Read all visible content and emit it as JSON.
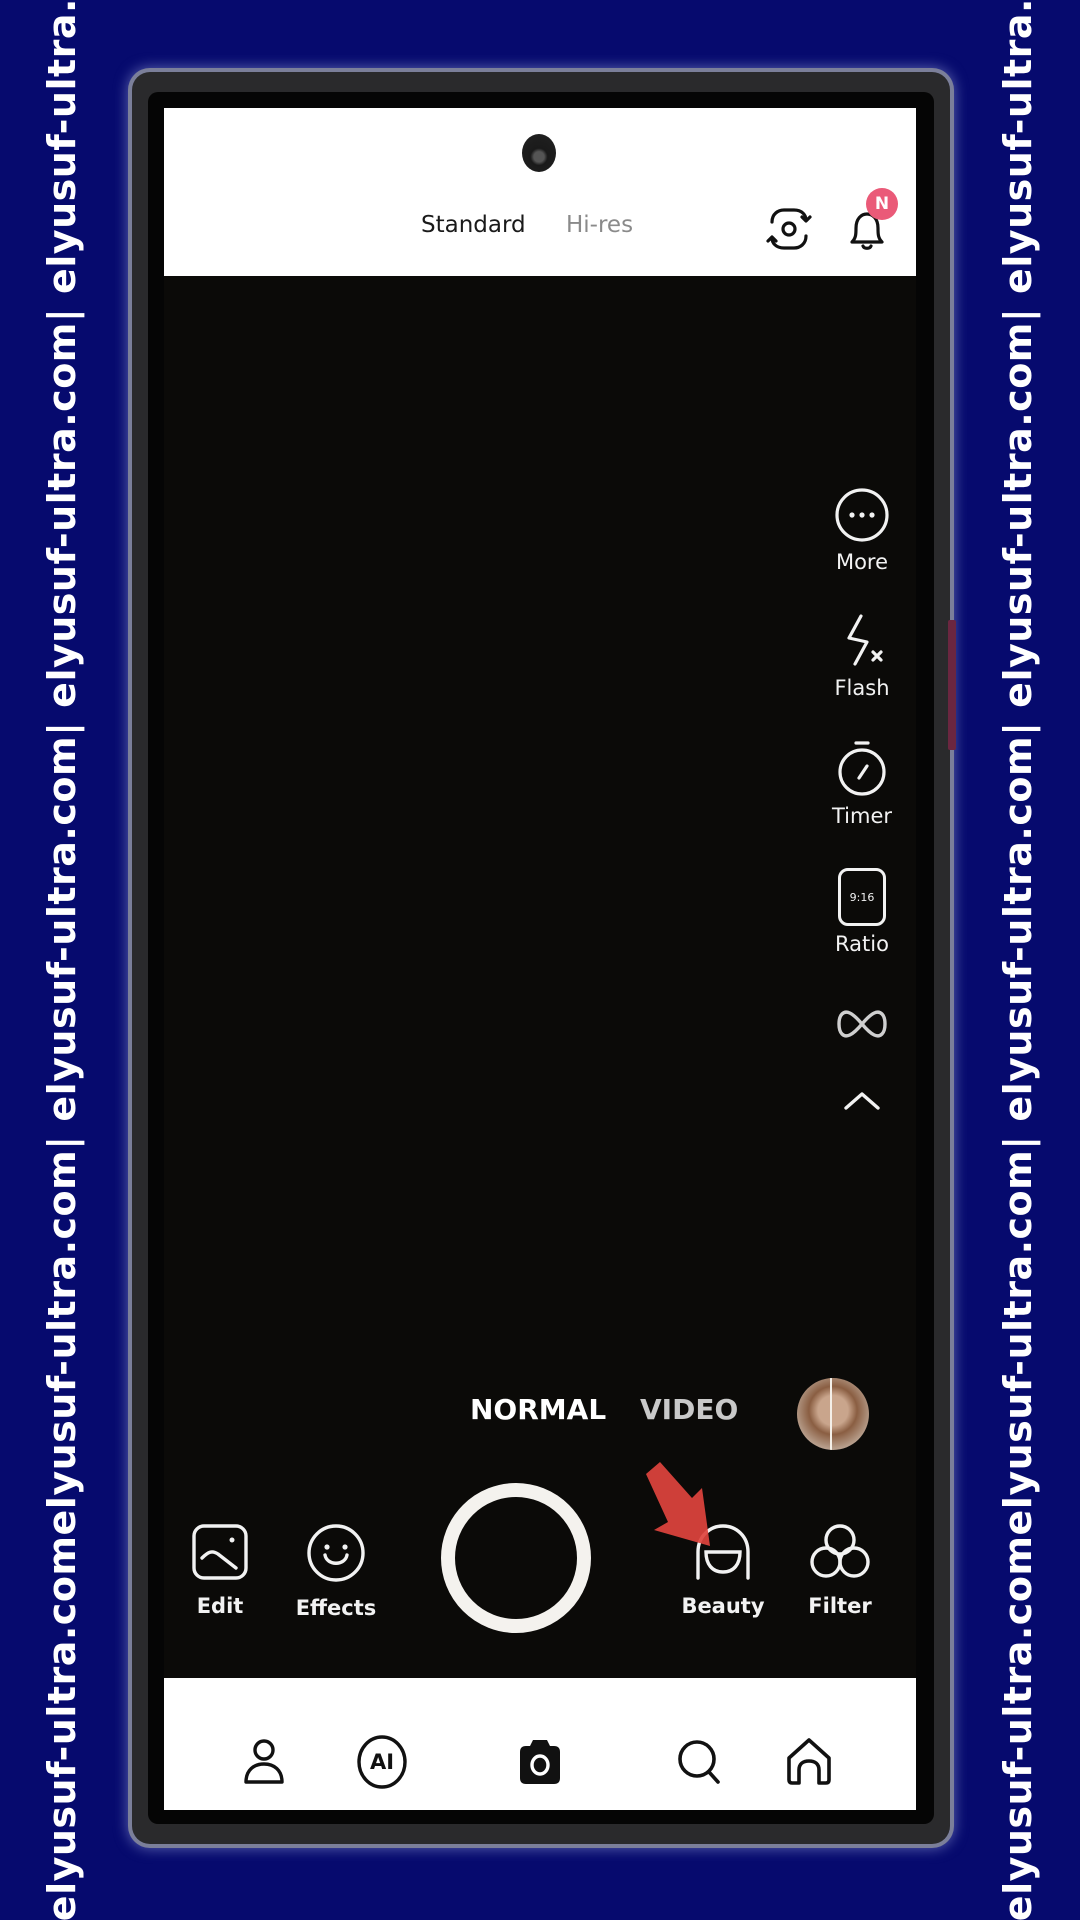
{
  "watermark": {
    "left_text": "elyusuf-ultra.comelyusuf-ultra.com| elyusuf-ultra.com| elyusuf-ultra.com| elyusuf-ultra.",
    "right_text": "elyusuf-ultra.comelyusuf-ultra.com| elyusuf-ultra.com| elyusuf-ultra.com| elyusuf-ultra."
  },
  "header": {
    "tabs": [
      {
        "label": "Standard",
        "active": true
      },
      {
        "label": "Hi-res",
        "active": false
      }
    ],
    "flip_camera_icon": "flip-camera-icon",
    "notifications": {
      "icon": "bell-icon",
      "badge": "N",
      "badge_color": "#ea5a78"
    }
  },
  "side_controls": [
    {
      "label": "More",
      "icon": "more-icon"
    },
    {
      "label": "Flash",
      "icon": "flash-off-icon"
    },
    {
      "label": "Timer",
      "icon": "timer-icon"
    },
    {
      "label": "Ratio",
      "icon": "ratio-icon",
      "value": "9:16"
    },
    {
      "label": "",
      "icon": "infinity-icon"
    },
    {
      "label": "",
      "icon": "chevron-up-icon"
    }
  ],
  "capture_modes": [
    {
      "label": "NORMAL",
      "active": true
    },
    {
      "label": "VIDEO",
      "active": false
    }
  ],
  "tools": [
    {
      "label": "Edit",
      "icon": "edit-image-icon"
    },
    {
      "label": "Effects",
      "icon": "effects-smiley-icon"
    },
    {
      "label": "Beauty",
      "icon": "beauty-icon"
    },
    {
      "label": "Filter",
      "icon": "filter-icon"
    }
  ],
  "annotation": {
    "arrow_color": "#e0443e",
    "points_to": "Beauty"
  },
  "bottom_nav": [
    {
      "name": "profile",
      "icon": "person-icon"
    },
    {
      "name": "ai",
      "icon": "ai-icon",
      "text": "AI"
    },
    {
      "name": "camera",
      "icon": "camera-icon",
      "active": true
    },
    {
      "name": "search",
      "icon": "search-icon"
    },
    {
      "name": "home",
      "icon": "home-icon"
    }
  ]
}
